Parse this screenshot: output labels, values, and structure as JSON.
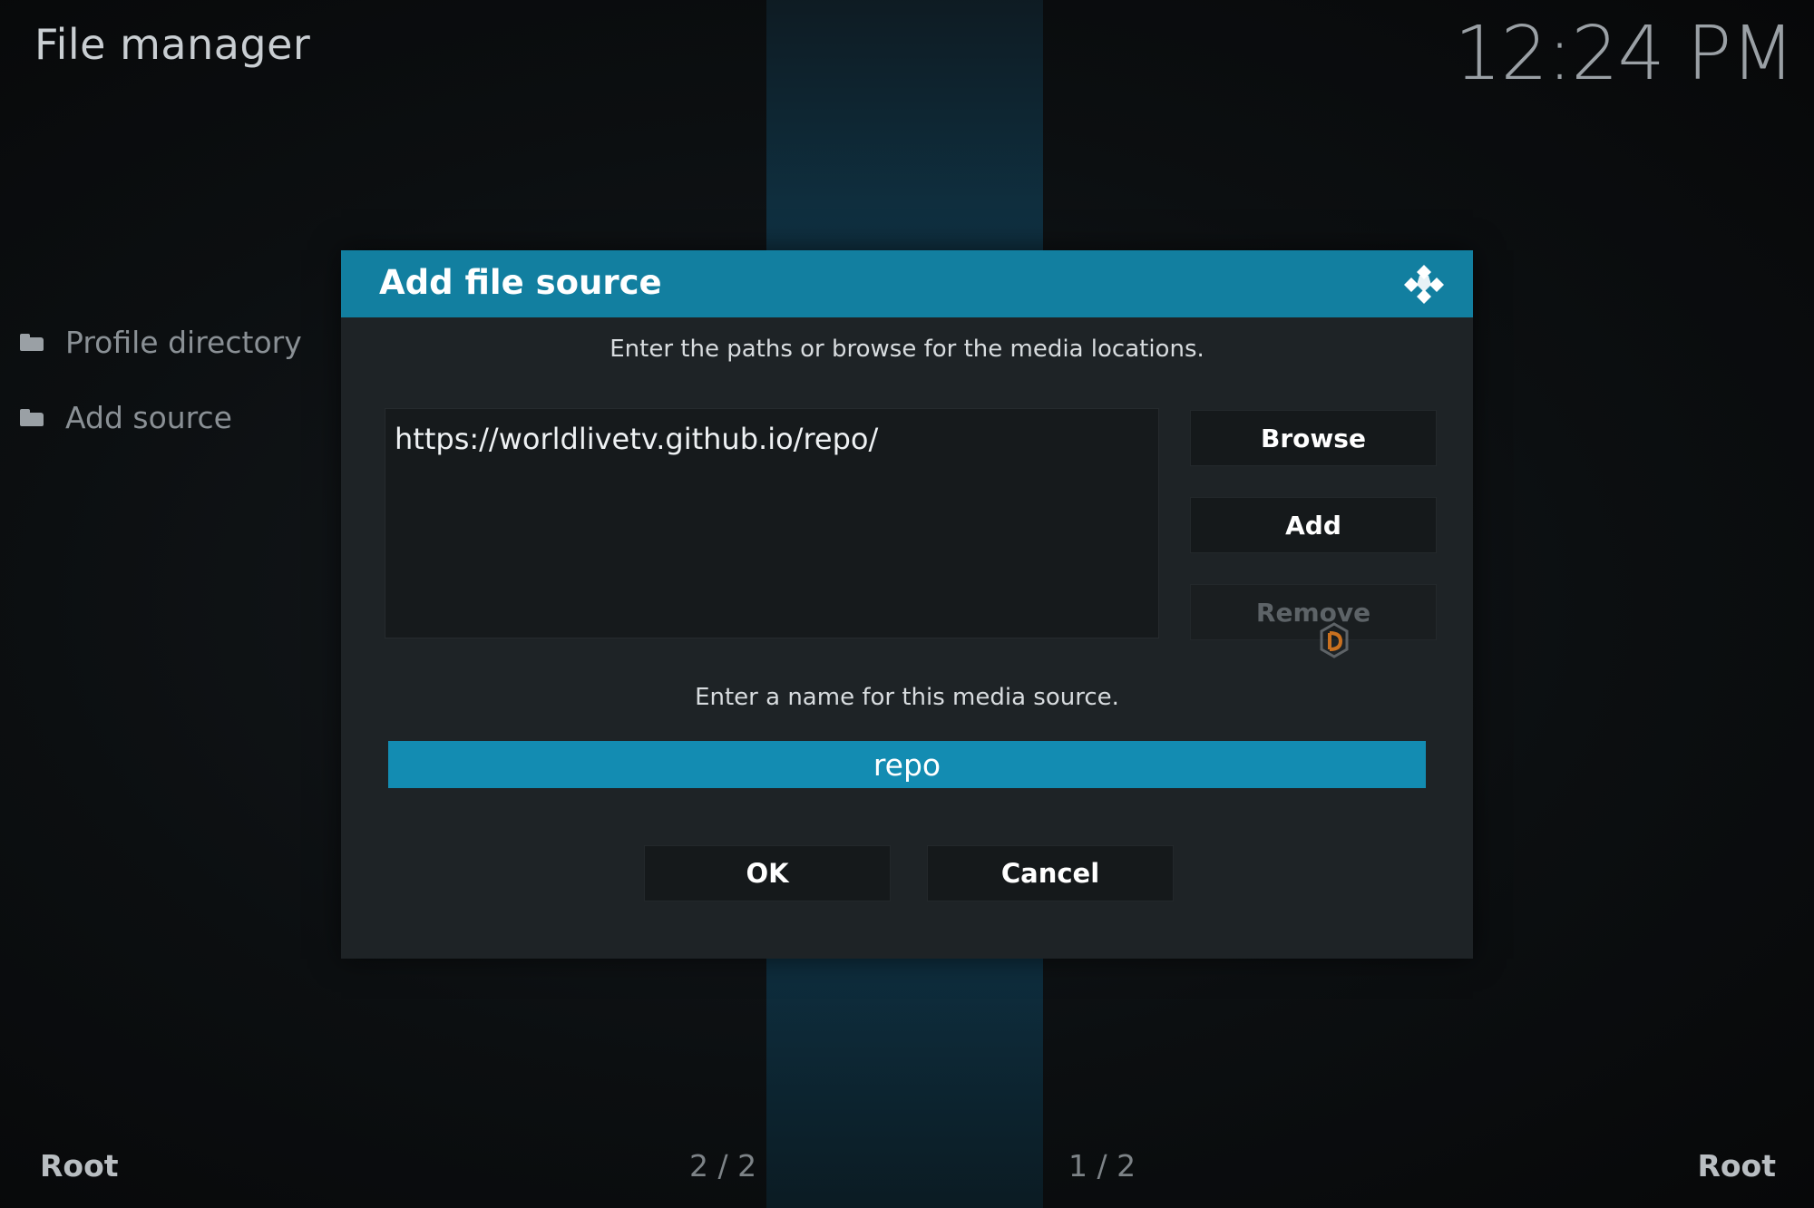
{
  "header": {
    "title": "File manager",
    "clock": "12:24 PM"
  },
  "sidebar": {
    "items": [
      {
        "label": "Profile directory",
        "icon": "folder-icon"
      },
      {
        "label": "Add source",
        "icon": "folder-icon"
      }
    ]
  },
  "dialog": {
    "title": "Add file source",
    "path_instructions": "Enter the paths or browse for the media locations.",
    "paths": [
      "https://worldlivetv.github.io/repo/"
    ],
    "buttons": {
      "browse": "Browse",
      "add": "Add",
      "remove": "Remove"
    },
    "name_instructions": "Enter a name for this media source.",
    "name_value": "repo",
    "ok_label": "OK",
    "cancel_label": "Cancel"
  },
  "footer": {
    "left_label": "Root",
    "left_page": "2 / 2",
    "right_page": "1 / 2",
    "right_label": "Root"
  },
  "colors": {
    "accent": "#127fa0",
    "input_focus": "#138cb2",
    "dialog_bg": "#1e2326"
  }
}
